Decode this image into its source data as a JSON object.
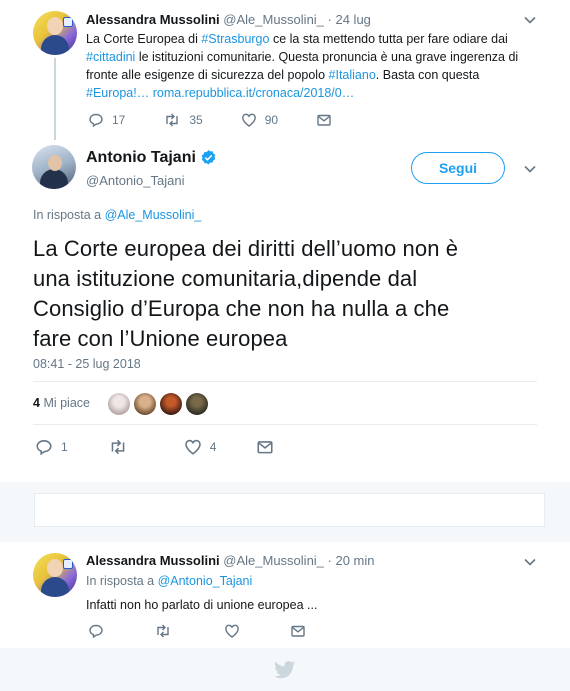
{
  "tweet_parent": {
    "author_name": "Alessandra Mussolini",
    "author_handle": "@Ale_Mussolini_",
    "time": "· 24 lug",
    "line1_a": "La Corte Europea di ",
    "line1_tag": "#Strasburgo",
    "line1_b": " ce la sta mettendo tutta per fare odiare dai",
    "line2_tag": "#cittadini",
    "line2_b": " le istituzioni comunitarie. Questa pronuncia è una grave ingerenza di",
    "line3_a": "fronte alle esigenze di sicurezza del popolo ",
    "line3_tag": "#Italiano",
    "line3_b": ". Basta con questa",
    "line4_tag": "#Europa!…",
    "line4_link": "roma.repubblica.it/cronaca/2018/0…",
    "replies": "17",
    "retweets": "35",
    "likes": "90"
  },
  "tweet_main": {
    "author_name": "Antonio Tajani",
    "author_handle": "@Antonio_Tajani",
    "follow_label": "Segui",
    "reply_prefix": "In risposta a",
    "reply_to": "@Ale_Mussolini_",
    "text_line1": "La Corte europea dei diritti dell’uomo non è",
    "text_line2": "una istituzione comunitaria,dipende dal",
    "text_line3": "Consiglio d’Europa che non ha nulla a che",
    "text_line4": "fare con l’Unione europea",
    "timestamp": "08:41 - 25 lug 2018",
    "likes_count": "4",
    "likes_label": "Mi piace",
    "replies": "1",
    "retweets": "",
    "likes": "4"
  },
  "tweet_reply": {
    "author_name": "Alessandra Mussolini",
    "author_handle": "@Ale_Mussolini_",
    "time": "· 20 min",
    "reply_prefix": "In risposta a",
    "reply_to": "@Antonio_Tajani",
    "text": "Infatti non ho parlato di unione europea ..."
  },
  "colors": {
    "accent": "#1da1f2",
    "link": "#1b95e0",
    "muted": "#657786",
    "verified": "#1da1f2"
  },
  "icons": [
    "reply-icon",
    "retweet-icon",
    "like-icon",
    "dm-icon",
    "chevron-down-icon",
    "verified-icon",
    "twitter-bird-icon"
  ]
}
